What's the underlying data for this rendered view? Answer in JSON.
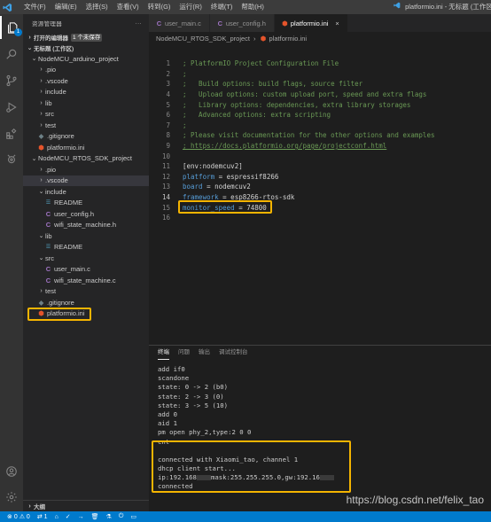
{
  "titlebar": {
    "menu": [
      "文件(F)",
      "编辑(E)",
      "选择(S)",
      "查看(V)",
      "转到(G)",
      "运行(R)",
      "终端(T)",
      "帮助(H)"
    ],
    "title": "platformio.ini - 无标题 (工作区)"
  },
  "activity": {
    "explorer_badge": "1"
  },
  "sidebar": {
    "header": "资源管理器",
    "more": "···",
    "open_editors": "打开的编辑器",
    "unsaved": "1 个未保存",
    "workspace": "无标题 (工作区)",
    "bottom": "大纲",
    "tree": [
      {
        "label": "NodeMCU_arduino_project",
        "indent": 0,
        "kind": "folder-open"
      },
      {
        "label": ".pio",
        "indent": 1,
        "kind": "folder"
      },
      {
        "label": ".vscode",
        "indent": 1,
        "kind": "folder"
      },
      {
        "label": "include",
        "indent": 1,
        "kind": "folder"
      },
      {
        "label": "lib",
        "indent": 1,
        "kind": "folder"
      },
      {
        "label": "src",
        "indent": 1,
        "kind": "folder"
      },
      {
        "label": "test",
        "indent": 1,
        "kind": "folder"
      },
      {
        "label": ".gitignore",
        "indent": 1,
        "kind": "git"
      },
      {
        "label": "platformio.ini",
        "indent": 1,
        "kind": "pio"
      },
      {
        "label": "NodeMCU_RTOS_SDK_project",
        "indent": 0,
        "kind": "folder-open"
      },
      {
        "label": ".pio",
        "indent": 1,
        "kind": "folder"
      },
      {
        "label": ".vscode",
        "indent": 1,
        "kind": "folder",
        "selected": true
      },
      {
        "label": "include",
        "indent": 1,
        "kind": "folder-open"
      },
      {
        "label": "README",
        "indent": 2,
        "kind": "readme"
      },
      {
        "label": "user_config.h",
        "indent": 2,
        "kind": "c"
      },
      {
        "label": "wifi_state_machine.h",
        "indent": 2,
        "kind": "c"
      },
      {
        "label": "lib",
        "indent": 1,
        "kind": "folder-open"
      },
      {
        "label": "README",
        "indent": 2,
        "kind": "readme"
      },
      {
        "label": "src",
        "indent": 1,
        "kind": "folder-open"
      },
      {
        "label": "user_main.c",
        "indent": 2,
        "kind": "c"
      },
      {
        "label": "wifi_state_machine.c",
        "indent": 2,
        "kind": "c"
      },
      {
        "label": "test",
        "indent": 1,
        "kind": "folder"
      },
      {
        "label": ".gitignore",
        "indent": 1,
        "kind": "git"
      },
      {
        "label": "platformio.ini",
        "indent": 1,
        "kind": "pio",
        "highlight": true
      }
    ]
  },
  "editor": {
    "tabs": [
      {
        "label": "user_main.c",
        "kind": "c"
      },
      {
        "label": "user_config.h",
        "kind": "c"
      },
      {
        "label": "platformio.ini",
        "kind": "pio",
        "active": true,
        "close": "×"
      }
    ],
    "breadcrumb": {
      "folder": "NodeMCU_RTOS_SDK_project",
      "sep": "›",
      "file": "platformio.ini"
    },
    "lines": [
      {
        "no": "1",
        "kind": "com",
        "text": "; PlatformIO Project Configuration File"
      },
      {
        "no": "2",
        "kind": "com",
        "text": ";"
      },
      {
        "no": "3",
        "kind": "com",
        "text": ";   Build options: build flags, source filter"
      },
      {
        "no": "4",
        "kind": "com",
        "text": ";   Upload options: custom upload port, speed and extra flags"
      },
      {
        "no": "5",
        "kind": "com",
        "text": ";   Library options: dependencies, extra library storages"
      },
      {
        "no": "6",
        "kind": "com",
        "text": ";   Advanced options: extra scripting"
      },
      {
        "no": "7",
        "kind": "com",
        "text": ";"
      },
      {
        "no": "8",
        "kind": "com",
        "text": "; Please visit documentation for the other options and examples"
      },
      {
        "no": "9",
        "kind": "link",
        "text": "; https://docs.platformio.org/page/projectconf.html"
      },
      {
        "no": "10",
        "kind": "plain",
        "text": ""
      },
      {
        "no": "11",
        "kind": "sec",
        "text": "[env:nodemcuv2]"
      },
      {
        "no": "12",
        "kind": "kv",
        "key": "platform",
        "val": " = espressif8266"
      },
      {
        "no": "13",
        "kind": "kv",
        "key": "board",
        "val": " = nodemcuv2"
      },
      {
        "no": "14",
        "kind": "kv",
        "key": "framework",
        "val": " = esp8266-rtos-sdk",
        "current": true
      },
      {
        "no": "15",
        "kind": "kv",
        "key": "monitor_speed",
        "val": " = 74800",
        "highlight": true
      },
      {
        "no": "16",
        "kind": "plain",
        "text": ""
      }
    ]
  },
  "panel": {
    "tabs": [
      "终端",
      "问题",
      "输出",
      "调试控制台"
    ],
    "terminal": [
      {
        "text": "add if0"
      },
      {
        "text": "scandone"
      },
      {
        "text": "state: 0 -> 2 (b0)"
      },
      {
        "text": "state: 2 -> 3 (0)"
      },
      {
        "text": "state: 3 -> 5 (10)"
      },
      {
        "text": "add 0"
      },
      {
        "text": "aid 1"
      },
      {
        "text": "pm open phy_2,type:2 0 0"
      },
      {
        "text": "cnt"
      },
      {
        "text": ""
      },
      {
        "text": "connected with Xiaomi_tao, channel 1"
      },
      {
        "text": "dhcp client start..."
      },
      {
        "parts": [
          "ip:192.168",
          "mask:255.255.255.0,gw:192.16",
          ""
        ]
      },
      {
        "text": "connected"
      }
    ],
    "watermark": "https://blog.csdn.net/felix_tao"
  },
  "statusbar": {
    "errors": "0",
    "warnings": "0",
    "remote": "1"
  },
  "colors": {
    "accent": "#007acc",
    "highlight_box": "#f4b400",
    "comment": "#6a9955",
    "keyword": "#569cd6"
  }
}
